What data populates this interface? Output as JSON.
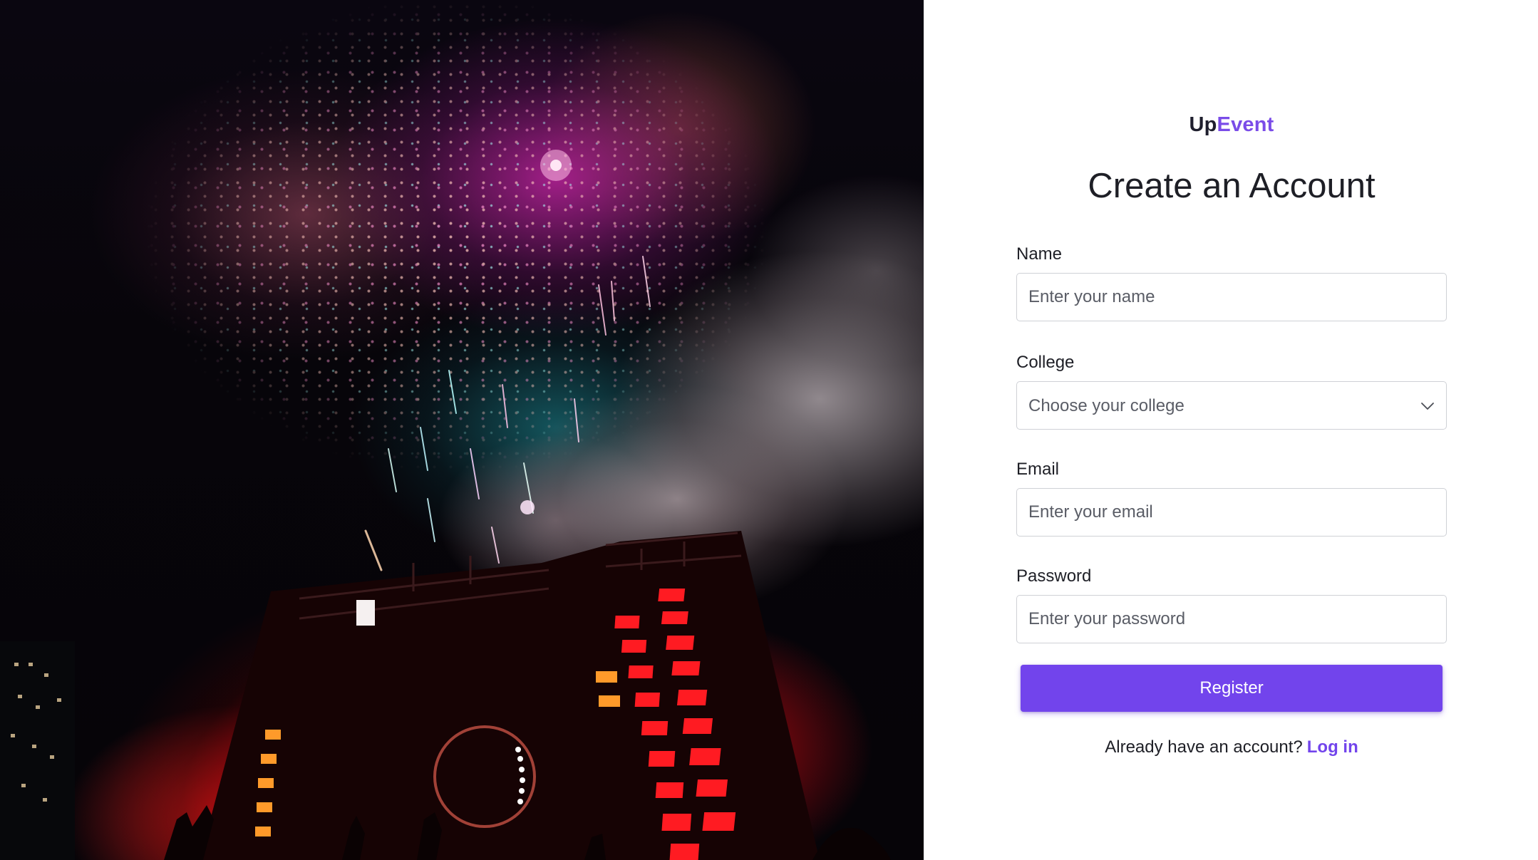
{
  "hero": {
    "image": "fireworks-over-concert-stage"
  },
  "brand": {
    "prefix": "Up",
    "accent": "Event"
  },
  "form": {
    "title": "Create an Account",
    "fields": {
      "name": {
        "label": "Name",
        "placeholder": "Enter your name"
      },
      "college": {
        "label": "College",
        "selected": "Choose your college"
      },
      "email": {
        "label": "Email",
        "placeholder": "Enter your email"
      },
      "password": {
        "label": "Password",
        "placeholder": "Enter your password"
      }
    },
    "register_label": "Register",
    "login_prompt": "Already have an account?",
    "login_link": "Log in"
  },
  "colors": {
    "accent": "#7244ec",
    "brand_accent": "#7a4ce8",
    "text": "#1e1f26",
    "border": "#cfd1d6"
  },
  "icons": {
    "select_indicator": "chevron-down-icon"
  }
}
